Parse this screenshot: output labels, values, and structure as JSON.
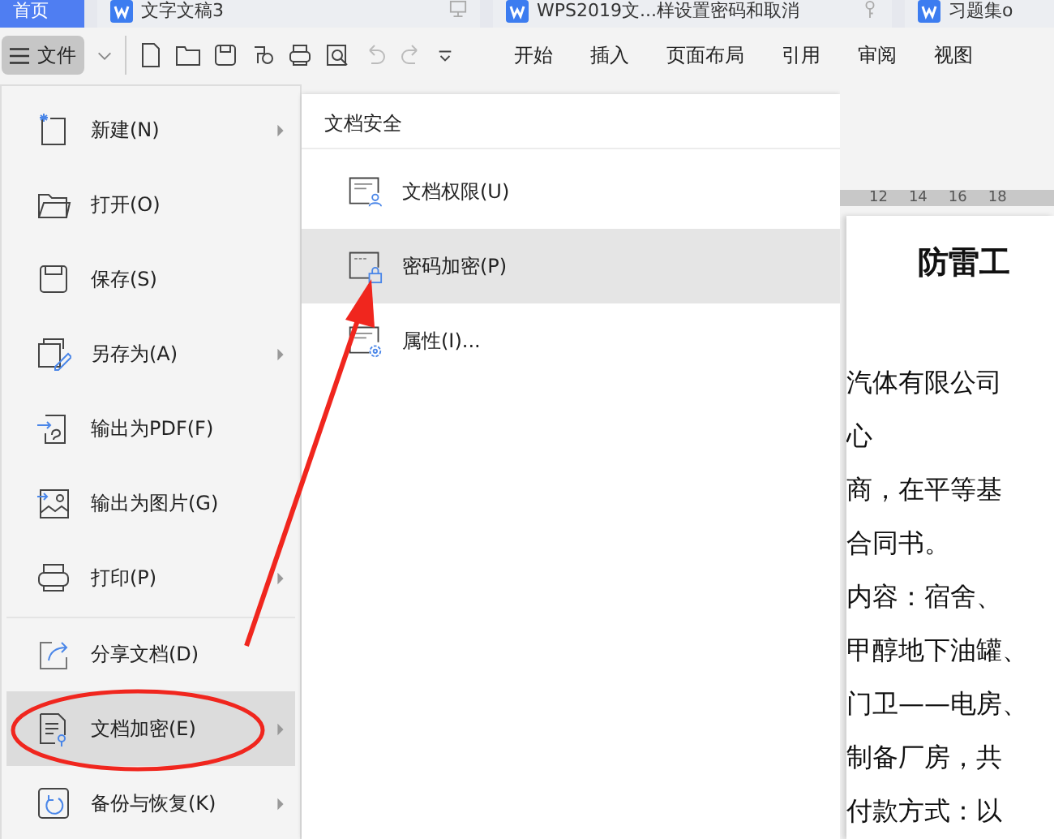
{
  "tabs": [
    {
      "label": "首页",
      "selected": true
    },
    {
      "label": "文字文稿3",
      "selected": false
    },
    {
      "label": "WPS2019文...样设置密码和取消",
      "selected": false
    },
    {
      "label": "习题集o",
      "selected": false
    }
  ],
  "toolbar": {
    "file_button": "文件",
    "ribbon_tabs": [
      "开始",
      "插入",
      "页面布局",
      "引用",
      "审阅",
      "视图"
    ]
  },
  "file_menu": {
    "items": [
      {
        "label": "新建(N)",
        "has_submenu": true,
        "selected": false,
        "separator_before": false
      },
      {
        "label": "打开(O)",
        "has_submenu": false,
        "selected": false,
        "separator_before": false
      },
      {
        "label": "保存(S)",
        "has_submenu": false,
        "selected": false,
        "separator_before": false
      },
      {
        "label": "另存为(A)",
        "has_submenu": true,
        "selected": false,
        "separator_before": false
      },
      {
        "label": "输出为PDF(F)",
        "has_submenu": false,
        "selected": false,
        "separator_before": false
      },
      {
        "label": "输出为图片(G)",
        "has_submenu": false,
        "selected": false,
        "separator_before": false
      },
      {
        "label": "打印(P)",
        "has_submenu": true,
        "selected": false,
        "separator_before": false
      },
      {
        "label": "分享文档(D)",
        "has_submenu": false,
        "selected": false,
        "separator_before": true
      },
      {
        "label": "文档加密(E)",
        "has_submenu": true,
        "selected": true,
        "separator_before": false
      },
      {
        "label": "备份与恢复(K)",
        "has_submenu": true,
        "selected": false,
        "separator_before": false
      }
    ]
  },
  "submenu": {
    "title": "文档安全",
    "items": [
      {
        "label": "文档权限(U)",
        "selected": false
      },
      {
        "label": "密码加密(P)",
        "selected": true
      },
      {
        "label": "属性(I)...",
        "selected": false
      }
    ]
  },
  "ruler": {
    "labels": [
      "12",
      "14",
      "16",
      "18"
    ]
  },
  "document": {
    "title": "防雷工",
    "lines": [
      "汽体有限公司",
      "心",
      "商，在平等基",
      "合同书。",
      "内容：宿舍、",
      "甲醇地下油罐、",
      "门卫——电房、",
      "制备厂房，共",
      "付款方式：以"
    ]
  }
}
